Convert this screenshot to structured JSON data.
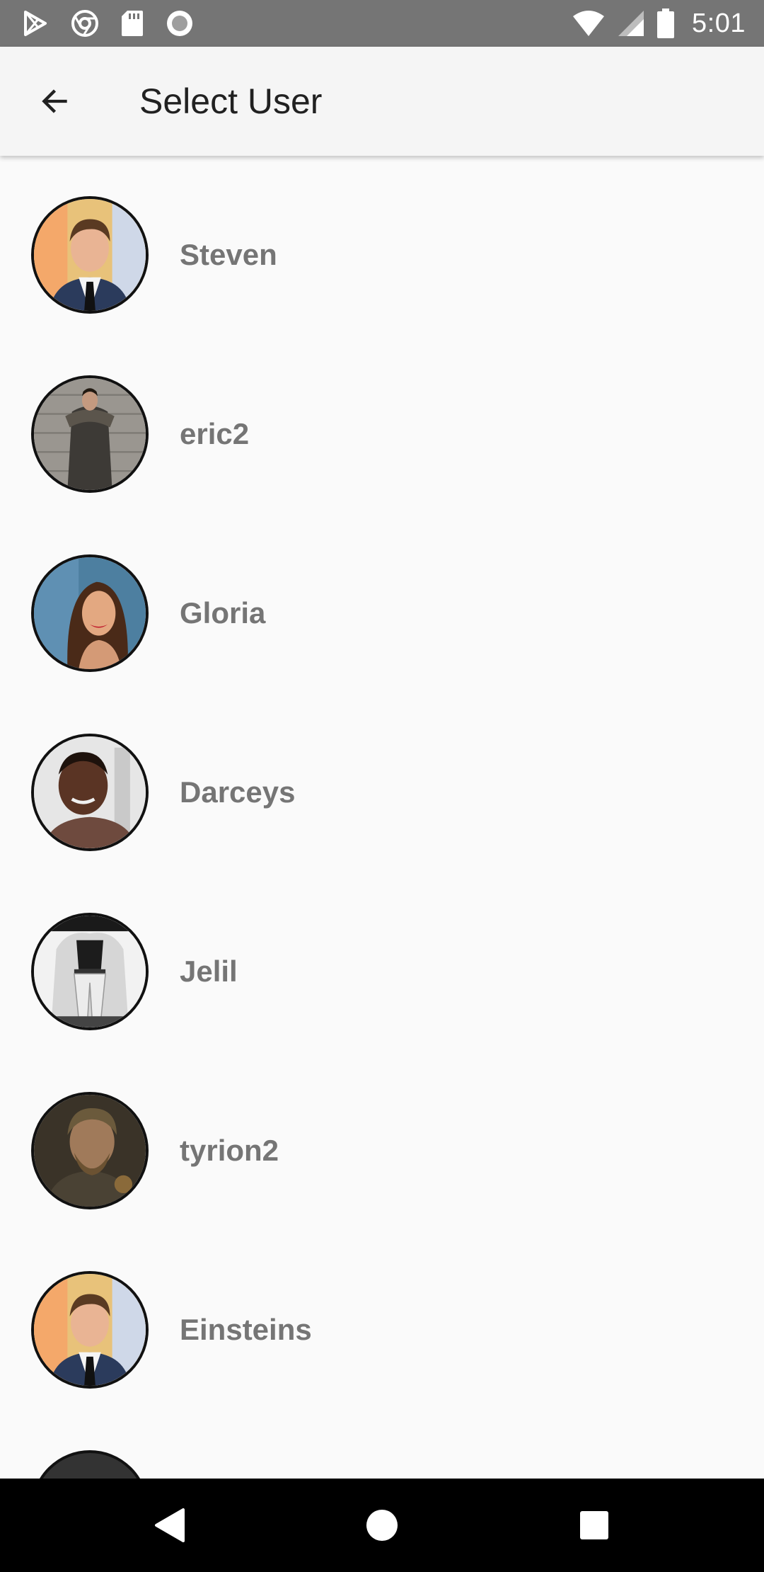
{
  "status_bar": {
    "left_icons": [
      "play-store-icon",
      "chrome-icon",
      "sd-card-icon",
      "record-icon"
    ],
    "right_icons": [
      "wifi-icon",
      "signal-icon",
      "battery-icon"
    ],
    "time": "5:01"
  },
  "app_bar": {
    "back_icon": "arrow-back-icon",
    "title": "Select User"
  },
  "users": [
    {
      "name": "Steven",
      "avatar": "man-suit-avatar"
    },
    {
      "name": "eric2",
      "avatar": "man-fur-coat-avatar"
    },
    {
      "name": "Gloria",
      "avatar": "woman-smiling-avatar"
    },
    {
      "name": "Darceys",
      "avatar": "man-selfie-avatar"
    },
    {
      "name": "Jelil",
      "avatar": "bw-fashion-avatar"
    },
    {
      "name": "tyrion2",
      "avatar": "bearded-man-avatar"
    },
    {
      "name": "Einsteins",
      "avatar": "man-suit-avatar"
    }
  ],
  "nav_bar": {
    "icons": [
      "back-triangle-icon",
      "home-circle-icon",
      "recents-square-icon"
    ]
  },
  "colors": {
    "status_bar_bg": "#757575",
    "app_bar_bg": "#f5f5f5",
    "page_bg": "#fafafa",
    "user_name": "#757575",
    "title": "#212121"
  }
}
